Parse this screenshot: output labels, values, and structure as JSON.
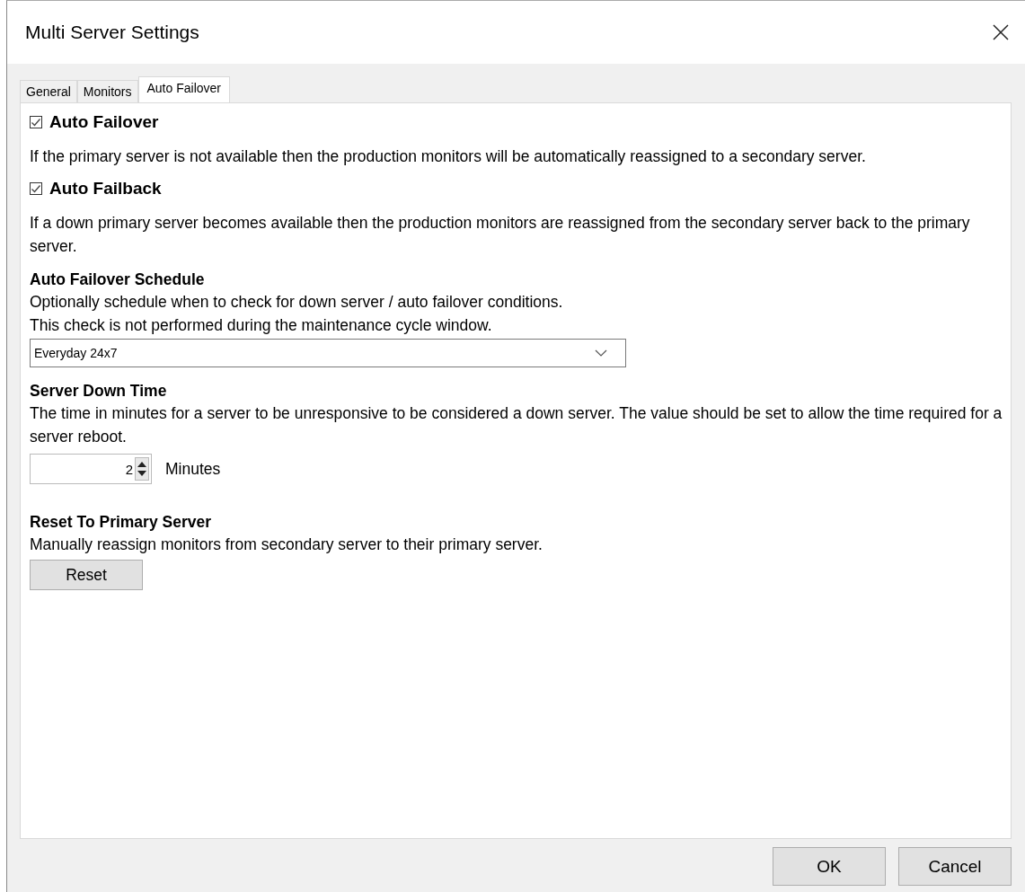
{
  "window": {
    "title": "Multi Server Settings"
  },
  "tabs": [
    {
      "label": "General",
      "selected": false
    },
    {
      "label": "Monitors",
      "selected": false
    },
    {
      "label": "Auto Failover",
      "selected": true
    }
  ],
  "options": [
    {
      "label": "Auto Failover",
      "checked": true,
      "description": "If the primary server is not available then the production monitors will be automatically reassigned to a secondary server."
    },
    {
      "label": "Auto Failback",
      "checked": true,
      "description": "If a down primary server becomes available then the production monitors are reassigned from the secondary server back to the primary server."
    }
  ],
  "schedule": {
    "heading": "Auto Failover Schedule",
    "lines": [
      "Optionally schedule when to check for down server / auto failover conditions.",
      "This check is not performed during the maintenance cycle window."
    ],
    "value": "Everyday 24x7"
  },
  "down_time": {
    "heading": "Server Down Time",
    "description": "The time in minutes for a server to be unresponsive to be considered a down server. The value should be set to allow the time required for a server reboot.",
    "value": "2",
    "unit": "Minutes"
  },
  "reset": {
    "heading": "Reset To Primary Server",
    "description": "Manually reassign monitors from secondary server to their primary server.",
    "button": "Reset"
  },
  "buttons": [
    "OK",
    "Cancel"
  ]
}
